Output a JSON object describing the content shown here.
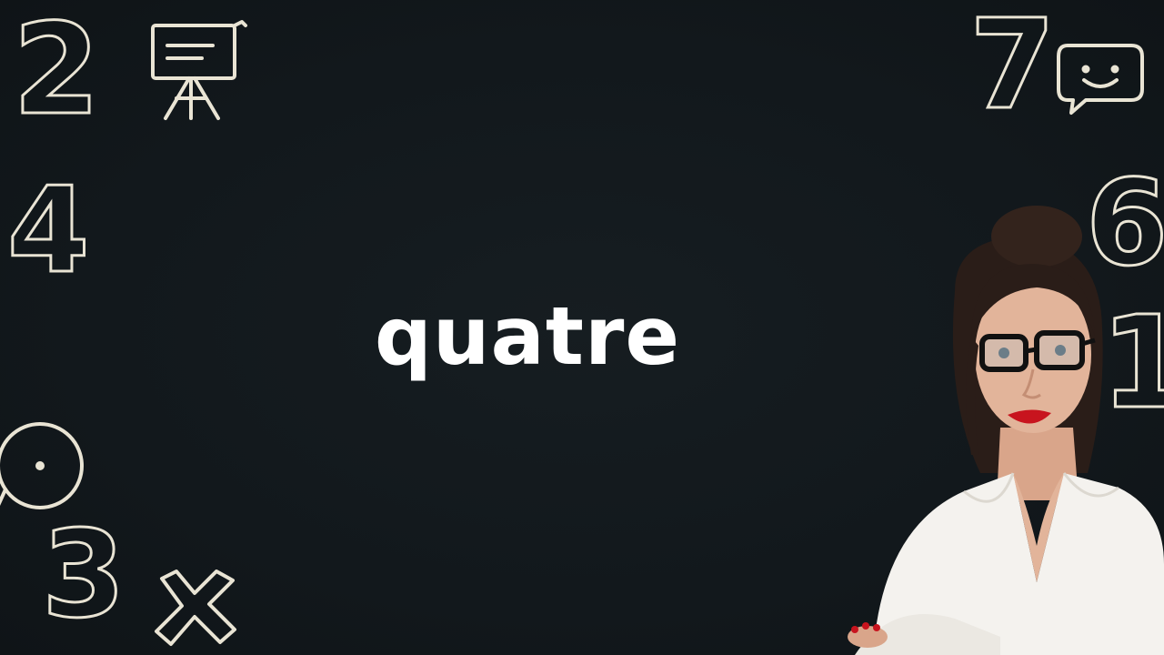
{
  "headline": {
    "word": "quatre"
  },
  "decor": {
    "numbers": {
      "two": "2",
      "four": "4",
      "three": "3",
      "seven": "7",
      "six": "6",
      "one": "1"
    },
    "icons": [
      "easel-icon",
      "chat-bubble-icon",
      "circle-icon",
      "multiply-icon"
    ],
    "outline_color": "#e9e4d4"
  },
  "colors": {
    "background": "#12181c",
    "text": "#ffffff",
    "presenter_blouse": "#f4f2ee",
    "presenter_hair": "#2a1d18",
    "presenter_lips": "#c8141e"
  }
}
